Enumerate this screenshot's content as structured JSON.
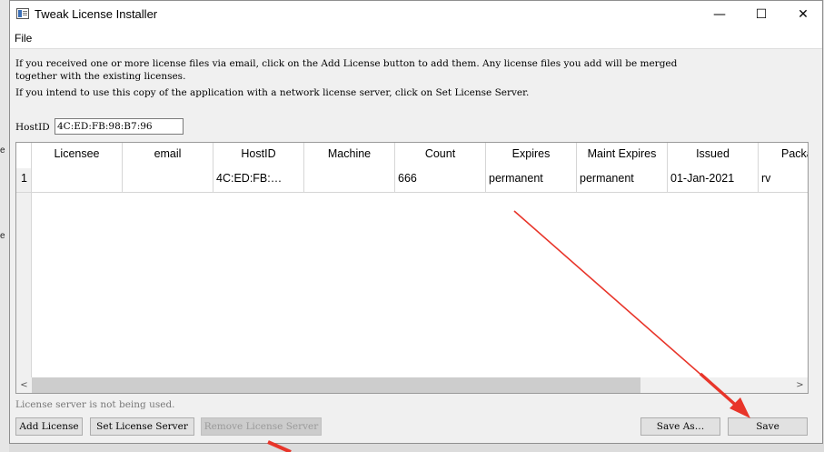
{
  "window": {
    "title": "Tweak License Installer",
    "minimize_glyph": "—",
    "maximize_glyph": "☐",
    "close_glyph": "✕"
  },
  "menu": {
    "file": "File"
  },
  "info": {
    "line1": "If you received one or more license files via email, click on the Add License button to add them. Any license files you add will be merged",
    "line2": "together with the existing licenses.",
    "line3": "If you intend to use this copy of the application with a network license server, click on Set License Server."
  },
  "hostid": {
    "label": "HostID",
    "value": "4C:ED:FB:98:B7:96"
  },
  "table": {
    "columns": [
      "Licensee",
      "email",
      "HostID",
      "Machine",
      "Count",
      "Expires",
      "Maint Expires",
      "Issued",
      "Packa"
    ],
    "rows": [
      {
        "num": "1",
        "cells": [
          "",
          "",
          "4C:ED:FB:…",
          "",
          "666",
          "permanent",
          "permanent",
          "01-Jan-2021",
          "rv"
        ]
      }
    ],
    "scroll_left": "<",
    "scroll_right": ">"
  },
  "status": "License server is not being used.",
  "buttons": {
    "add_license": "Add License",
    "set_license_server": "Set License Server",
    "remove_license_server": "Remove License Server",
    "save_as": "Save As…",
    "save": "Save"
  },
  "background": {
    "frag1": "e",
    "frag2": "e"
  },
  "colors": {
    "annotation_arrow": "#e8352a",
    "window_bg": "#f0f0f0"
  }
}
